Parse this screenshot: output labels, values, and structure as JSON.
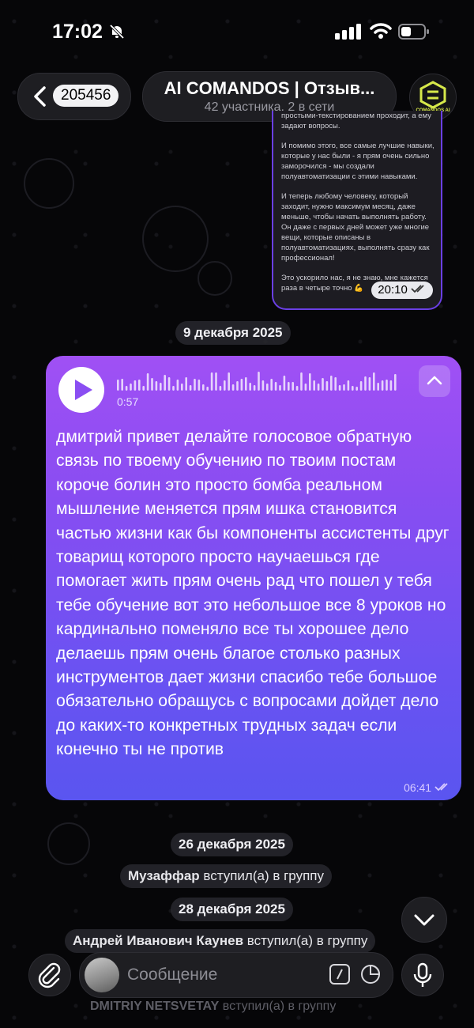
{
  "status_bar": {
    "time": "17:02"
  },
  "header": {
    "back_badge": "205456",
    "title": "AI COMANDOS | Отзыв...",
    "subtitle": "42 участника, 2 в сети",
    "avatar_label": "COMANDOS AI"
  },
  "previous_message": {
    "paragraphs": [
      "простыми-текстированием проходит, а ему задают вопросы.",
      "И помимо этого, все самые лучшие навыки, которые у нас были - я прям очень сильно заморочился - мы создали полуавтоматизации с этими навыками.",
      "И теперь любому человеку, который заходит, нужно максимум месяц, даже меньше, чтобы начать выполнять работу. Он даже с первых дней может уже многие вещи, которые описаны в полуавтоматизациях, выполнять сразу как профессионал!",
      "Это ускорило нас, я не знаю, мне кажется раза в четыре точно 💪"
    ],
    "time": "20:10"
  },
  "dates": {
    "first": "9 декабря 2025",
    "second": "26 декабря 2025",
    "third": "28 декабря 2025"
  },
  "voice_message": {
    "duration": "0:57",
    "transcript": "дмитрий привет делайте голосовое обратную связь по твоему обучению по твоим постам короче болин это просто бомба реальном мышление меняется прям ишка становится частью жизни как бы компоненты ассистенты друг товарищ которого просто научаешься где помогает жить прям очень рад что пошел у тебя тебе обучение вот это небольшое все 8 уроков но кардинально поменяло все ты хорошее дело делаешь прям очень благое столько разных инструментов дает жизни спасибо тебе большое обязательно обращусь с вопросами дойдет дело до каких-то конкретных трудных задач если конечно ты не против",
    "time": "06:41"
  },
  "system_events": [
    {
      "name": "Музаффар",
      "action": "вступил(а) в группу"
    },
    {
      "name": "Андрей Иванович Каунев",
      "action": "вступил(а) в группу"
    },
    {
      "name": "DMITRIY NETSVETAY",
      "action": "вступил(а) в группу"
    }
  ],
  "input": {
    "placeholder": "Сообщение"
  },
  "colors": {
    "bubble_top": "#a050f4",
    "bubble_bottom": "#5a55f0",
    "accent": "#6a3fe4"
  }
}
